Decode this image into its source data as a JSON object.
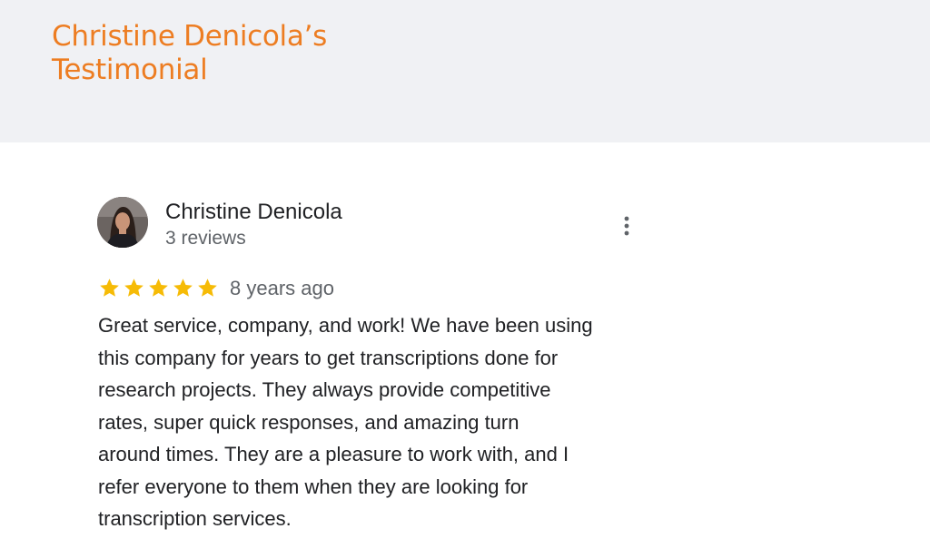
{
  "header": {
    "title_lines": [
      "Christine Denicola’s",
      "Testimonial"
    ],
    "title_color": "#ed7d22",
    "background": "#f0f1f4"
  },
  "review": {
    "reviewer_name": "Christine Denicola",
    "review_count": "3 reviews",
    "avatar_icon": "profile-photo",
    "menu_icon": "more-vert-icon",
    "rating": 5,
    "rating_max": 5,
    "star_color": "#f6bb06",
    "date": "8 years ago",
    "text_lines": [
      "Great service, company, and work! We have been using",
      "this company for years to get transcriptions done for",
      "research projects. They always provide competitive",
      "rates, super quick responses, and amazing turn",
      "around times. They are a pleasure to work with, and I",
      "refer everyone to them when they are looking for",
      "transcription services."
    ]
  }
}
